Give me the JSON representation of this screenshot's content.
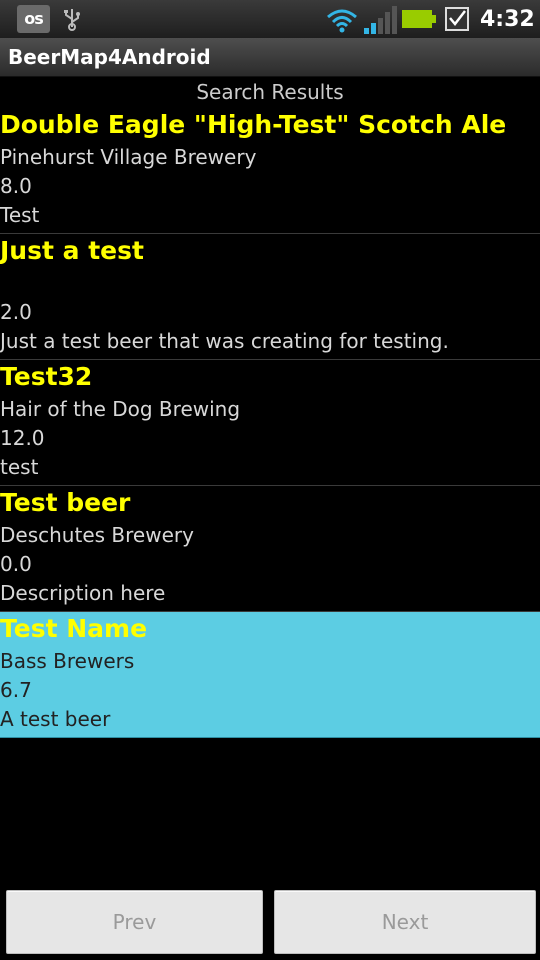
{
  "status": {
    "time": "4:32",
    "notification_label": "os"
  },
  "app": {
    "title": "BeerMap4Android"
  },
  "header": "Search Results",
  "beers": [
    {
      "name": "Double Eagle \"High-Test\" Scotch Ale",
      "brewery": "Pinehurst Village Brewery",
      "abv": "8.0",
      "description": "Test"
    },
    {
      "name": "Just a test",
      "brewery": "",
      "abv": "2.0",
      "description": "Just a test beer that was creating for testing."
    },
    {
      "name": "Test32",
      "brewery": "Hair of the Dog Brewing",
      "abv": "12.0",
      "description": "test"
    },
    {
      "name": "Test beer",
      "brewery": "Deschutes Brewery",
      "abv": "0.0",
      "description": "Description here"
    },
    {
      "name": "Test Name",
      "brewery": "Bass Brewers",
      "abv": "6.7",
      "description": "A test beer",
      "selected": true
    }
  ],
  "buttons": {
    "prev": "Prev",
    "next": "Next"
  },
  "colors": {
    "name": "#ffff00",
    "selected_bg": "#5ccde3",
    "background": "#000000"
  },
  "icons": [
    "lastfm-icon",
    "usb-icon",
    "wifi-icon",
    "signal-icon",
    "battery-icon",
    "checkbox-notification-icon"
  ]
}
